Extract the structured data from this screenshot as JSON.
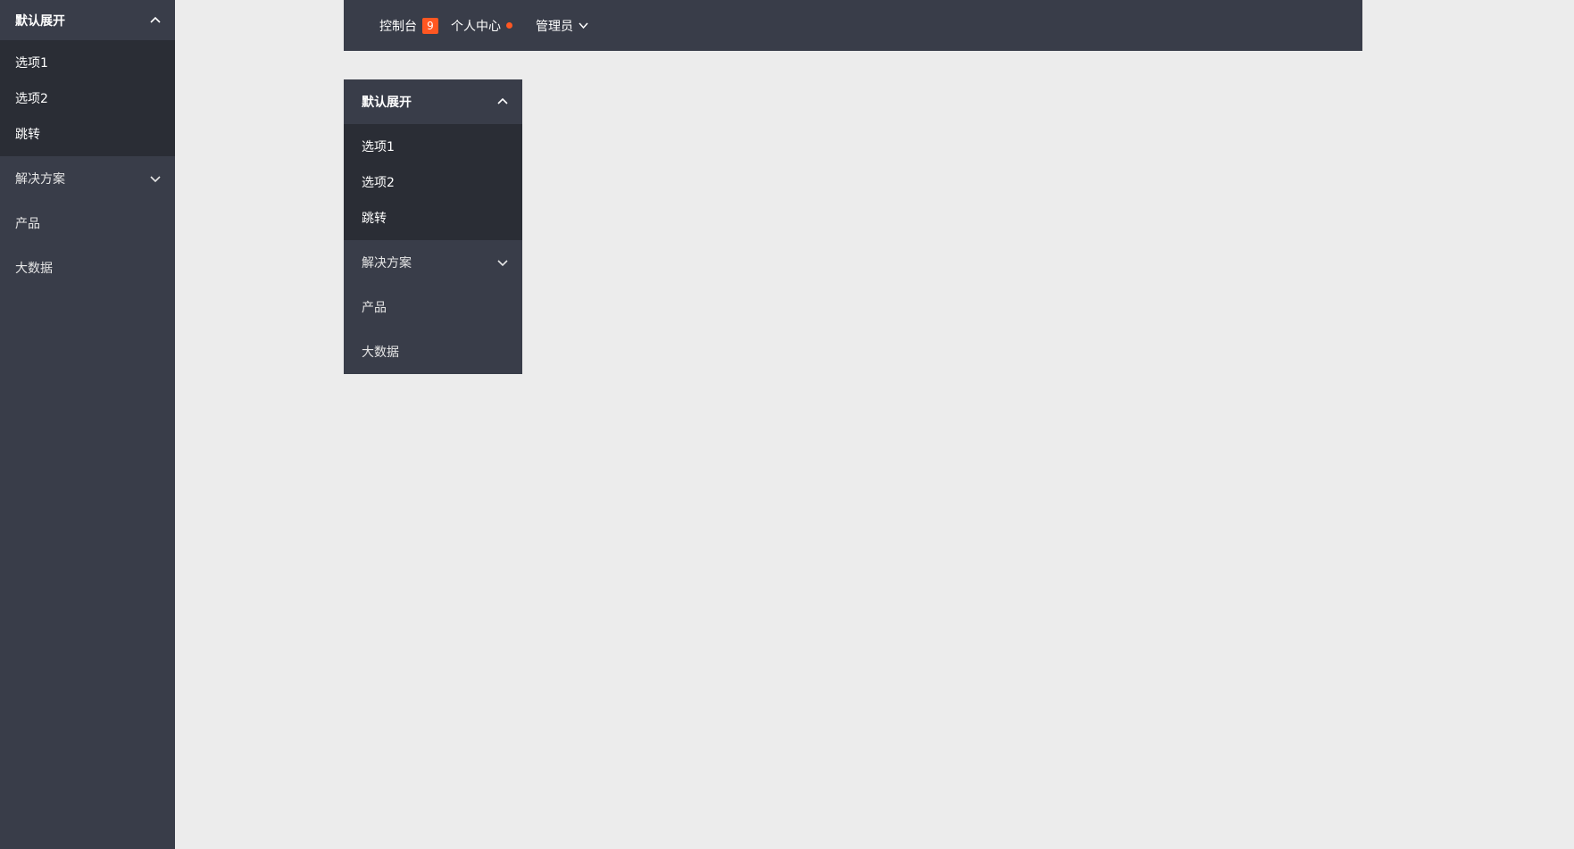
{
  "sidebar": {
    "group_open": {
      "label": "默认展开",
      "items": [
        {
          "label": "选项1"
        },
        {
          "label": "选项2"
        },
        {
          "label": "跳转"
        }
      ]
    },
    "items": [
      {
        "label": "解决方案",
        "expandable": true
      },
      {
        "label": "产品"
      },
      {
        "label": "大数据"
      }
    ]
  },
  "topbar": {
    "items": [
      {
        "label": "控制台",
        "badge": "9"
      },
      {
        "label": "个人中心",
        "dot": true
      },
      {
        "label": "管理员",
        "dropdown": true
      }
    ]
  },
  "panel": {
    "group_open": {
      "label": "默认展开",
      "items": [
        {
          "label": "选项1"
        },
        {
          "label": "选项2"
        },
        {
          "label": "跳转"
        }
      ]
    },
    "items": [
      {
        "label": "解决方案",
        "expandable": true
      },
      {
        "label": "产品"
      },
      {
        "label": "大数据"
      }
    ]
  },
  "colors": {
    "nav_bg": "#393d49",
    "submenu_bg": "#2a2d35",
    "page_bg": "#ececec",
    "accent": "#ff5722"
  },
  "icons": {
    "chevron_up": "chevron-up-icon",
    "chevron_down": "chevron-down-icon",
    "notification_dot": "dot-icon"
  }
}
